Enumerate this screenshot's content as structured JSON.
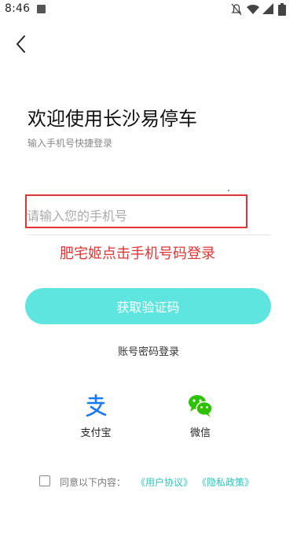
{
  "status_bar": {
    "time": "8:46",
    "app_icon": "a-notification-icon",
    "icons": [
      "mute-icon",
      "wifi-icon",
      "signal-icon",
      "battery-icon"
    ]
  },
  "nav": {
    "back_icon": "chevron-left-icon"
  },
  "header": {
    "title": "欢迎使用长沙易停车",
    "subtitle": "输入手机号快捷登录"
  },
  "phone": {
    "placeholder": "请输入您的手机号",
    "value": ""
  },
  "annotation": {
    "text": "肥宅姬点击手机号码登录",
    "color": "#e13434"
  },
  "buttons": {
    "get_code": "获取验证码",
    "password_login": "账号密码登录"
  },
  "social": {
    "alipay_label": "支付宝",
    "wechat_label": "微信"
  },
  "agreement": {
    "checked": false,
    "text": "同意以下内容：",
    "user_agreement": "《用户协议》",
    "privacy_policy": "《隐私政策》"
  },
  "colors": {
    "accent": "#5fe5df",
    "link": "#25c7c0",
    "alipay": "#1677ff",
    "wechat": "#2dc100",
    "highlight": "#e13434"
  }
}
